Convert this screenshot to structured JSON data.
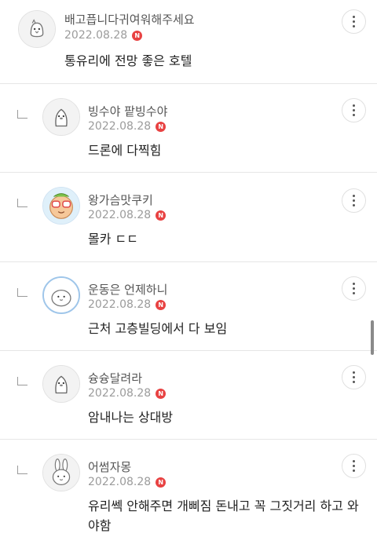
{
  "comments": [
    {
      "nick": "배고픕니다귀여워해주세요",
      "date": "2022.08.28",
      "badge": "N",
      "text": "통유리에 전망 좋은 호텔",
      "avatar": "chick-avatar-icon"
    },
    {
      "nick": "빙수야 팥빙수야",
      "date": "2022.08.28",
      "badge": "N",
      "text": "드론에 다찍힘",
      "avatar": "penguin-avatar-icon"
    },
    {
      "nick": "왕가슴맛쿠키",
      "date": "2022.08.28",
      "badge": "N",
      "text": "몰카 ㄷㄷ",
      "avatar": "cookie-avatar-icon"
    },
    {
      "nick": "운동은 언제하니",
      "date": "2022.08.28",
      "badge": "N",
      "text": "근처 고층빌딩에서 다 보임",
      "avatar": "blob-avatar-icon"
    },
    {
      "nick": "슝슝달려라",
      "date": "2022.08.28",
      "badge": "N",
      "text": "암내나는 상대방",
      "avatar": "penguin-avatar-icon"
    },
    {
      "nick": "어썸자몽",
      "date": "2022.08.28",
      "badge": "N",
      "text": "유리쎅 안해주면 개삐짐 돈내고 꼭 그짓거리 하고 와야함",
      "avatar": "bunny-avatar-icon"
    }
  ]
}
